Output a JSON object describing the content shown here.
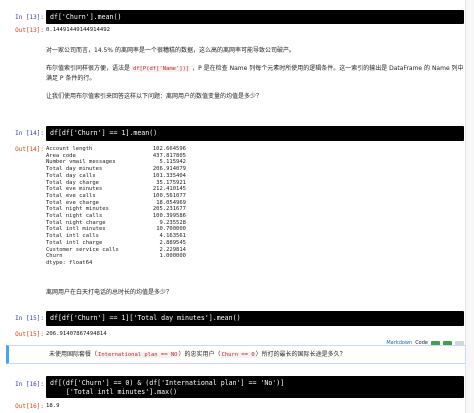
{
  "cells": {
    "c13": {
      "in_label": "In [13]:",
      "code": "df['Churn'].mean()",
      "out_label": "Out[13]:",
      "output": "0.14491449144914492"
    },
    "md1": {
      "p1": "对一家公司而言，14.5% 的离网率是一个很糟糕的数据，这么高的离网率可能导致公司破产。",
      "p2_a": "布尔值索引同样很方便，语法是",
      "p2_code": "df[P(df['Name'])]",
      "p2_b": "，P 是在检查 Name 列每个元素时所使用的逻辑条件。这一索引的输出是 DataFrame 的 Name 列中满足 P 条件的行。",
      "p3": "让我们使用布尔值索引来回答这样以下问题：离网用户的数值变量的均值是多少？"
    },
    "c14": {
      "in_label": "In [14]:",
      "code": "df[df['Churn'] == 1].mean()",
      "out_label": "Out[14]:",
      "rows": [
        {
          "k": "Account length",
          "v": "102.664596"
        },
        {
          "k": "Area code",
          "v": "437.817805"
        },
        {
          "k": "Number vmail messages",
          "v": "5.115942"
        },
        {
          "k": "Total day minutes",
          "v": "206.914079"
        },
        {
          "k": "Total day calls",
          "v": "101.335404"
        },
        {
          "k": "Total day charge",
          "v": "35.175921"
        },
        {
          "k": "Total eve minutes",
          "v": "212.410145"
        },
        {
          "k": "Total eve calls",
          "v": "100.561077"
        },
        {
          "k": "Total eve charge",
          "v": "18.054969"
        },
        {
          "k": "Total night minutes",
          "v": "205.231677"
        },
        {
          "k": "Total night calls",
          "v": "100.399586"
        },
        {
          "k": "Total night charge",
          "v": "9.235528"
        },
        {
          "k": "Total intl minutes",
          "v": "10.700000"
        },
        {
          "k": "Total intl calls",
          "v": "4.163561"
        },
        {
          "k": "Total intl charge",
          "v": "2.889545"
        },
        {
          "k": "Customer service calls",
          "v": "2.229814"
        },
        {
          "k": "Churn",
          "v": "1.000000"
        }
      ],
      "dtype": "dtype: float64"
    },
    "md2": {
      "p1": "离网用户在白天打电话的总时长的均值是多少？"
    },
    "c15": {
      "in_label": "In [15]:",
      "code": "df[df['Churn'] == 1]['Total day minutes'].mean()",
      "out_label": "Out[15]:",
      "output": "206.91407867494814"
    },
    "md3": {
      "p_a": "未使用国际套餐（",
      "code_a": "International plan == NO",
      "p_b": "）的忠实用户（",
      "code_b": "Churn == 0",
      "p_c": "）所打的最长的国际长途是多久？",
      "toolbar": {
        "type": "Markdown",
        "code": "Code"
      }
    },
    "c16": {
      "in_label": "In [16]:",
      "code_l1": "df[(df['Churn'] == 0) & (df['International plan'] == 'No')]",
      "code_l2": "    ['Total intl minutes'].max()",
      "out_label": "Out[16]:",
      "output": "18.9"
    }
  }
}
